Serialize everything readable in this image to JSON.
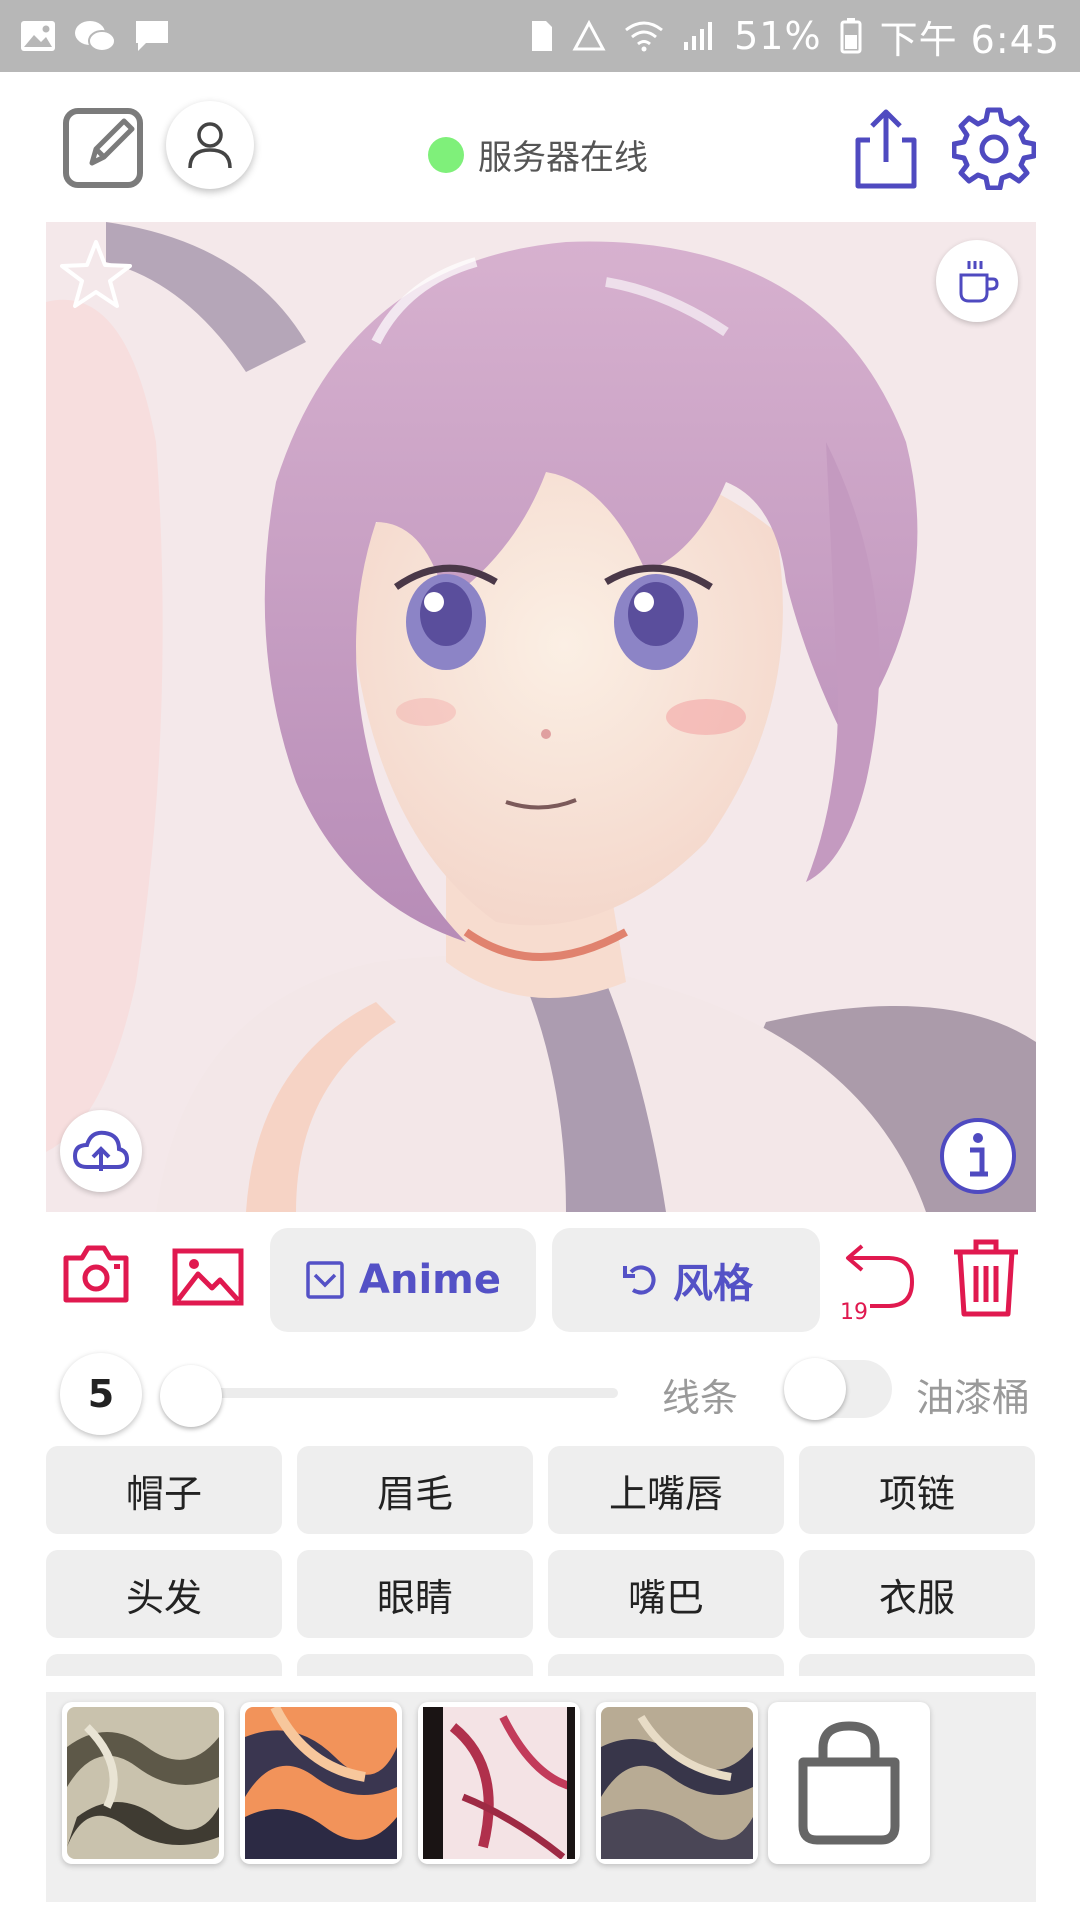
{
  "status_bar": {
    "battery_percent": "51%",
    "time": "下午 6:45"
  },
  "header": {
    "server_status": "服务器在线"
  },
  "actions": {
    "model_label": "Anime",
    "style_label": "风格",
    "undo_count": "19"
  },
  "stroke": {
    "size_value": "5",
    "line_label": "线条",
    "bucket_label": "油漆桶",
    "bucket_enabled": false
  },
  "parts": {
    "row1": [
      "帽子",
      "眉毛",
      "上嘴唇",
      "项链"
    ],
    "row2": [
      "头发",
      "眼睛",
      "嘴巴",
      "衣服"
    ]
  },
  "styles": {
    "swatch_count": 4,
    "store_icon": "shopping-bag-icon"
  },
  "colors": {
    "accent_red": "#e0194f",
    "accent_purple": "#4f4ac0",
    "online_green": "#7ff07a"
  }
}
